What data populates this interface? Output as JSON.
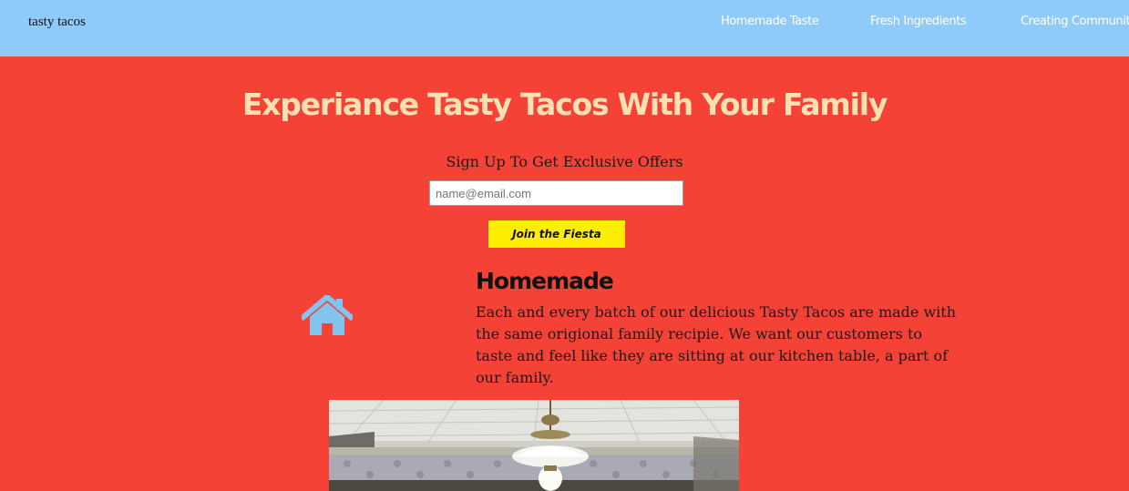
{
  "nav": {
    "brand": "tasty tacos",
    "links": [
      "Homemade Taste",
      "Fresh Ingredients",
      "Creating Community"
    ]
  },
  "hero": {
    "title": "Experiance Tasty Tacos With Your Family",
    "signup_label": "Sign Up To Get Exclusive Offers",
    "email_placeholder": "name@email.com",
    "button_label": "Join the Fiesta"
  },
  "feature": {
    "icon": "home-icon",
    "heading": "Homemade",
    "text": "Each and every batch of our delicious Tasty Tacos are made with the same origional family recipie. We want our customers to taste and feel like they are sitting at our kitchen table, a part of our family."
  },
  "colors": {
    "page_background": "#f44336",
    "nav_background": "#90caf9",
    "title_color": "#ffe0b2",
    "button_background": "#ffee00",
    "icon_color": "#81c4ee"
  }
}
